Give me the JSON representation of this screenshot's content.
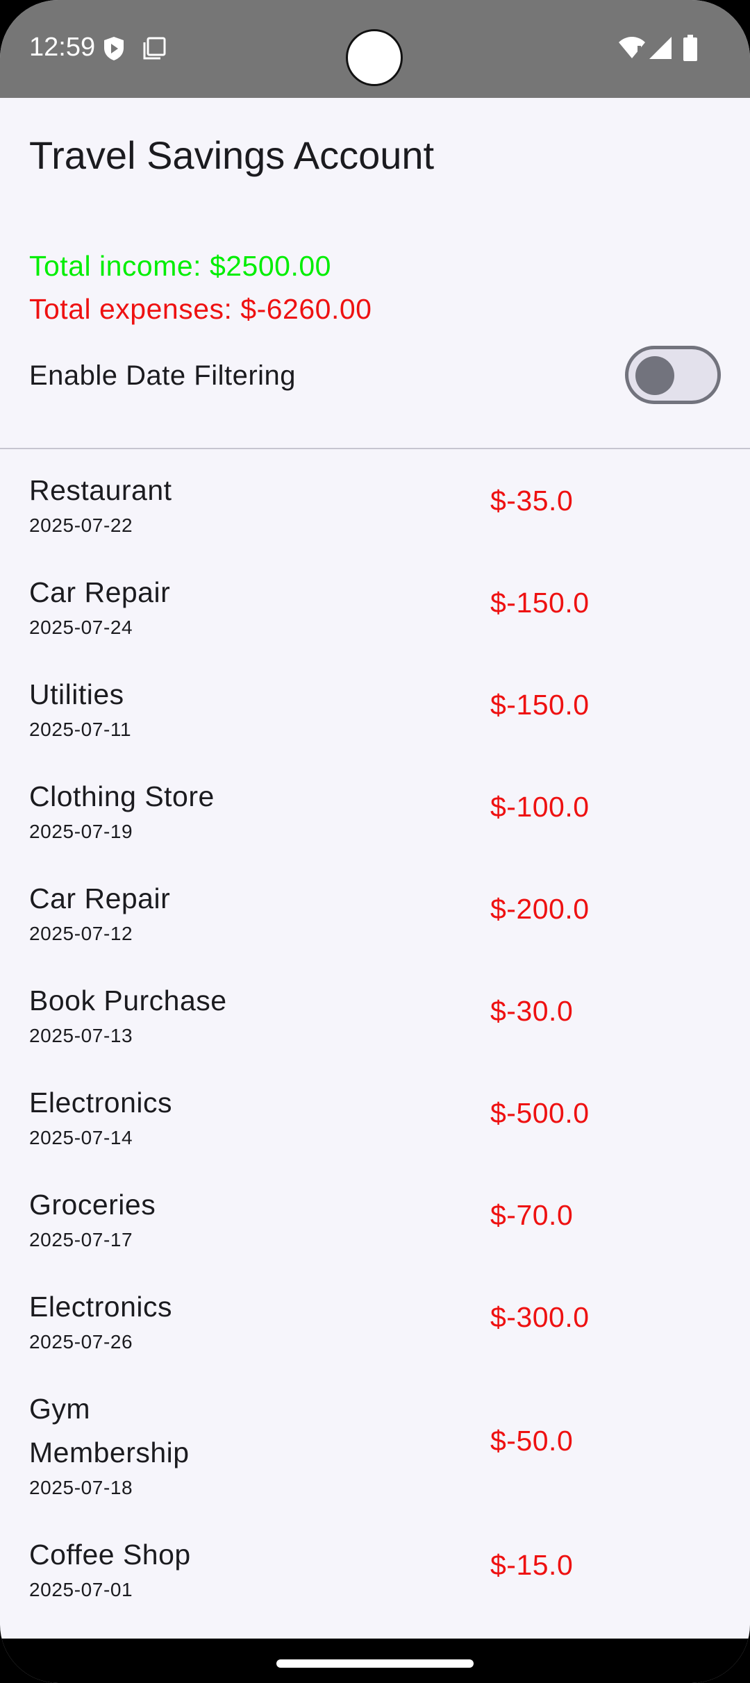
{
  "status_bar": {
    "time": "12:59",
    "icons_left": [
      "shield-icon",
      "screenshot-icon"
    ],
    "icons_right": [
      "wifi-icon",
      "signal-icon",
      "battery-icon"
    ]
  },
  "header": {
    "title": "Travel Savings Account"
  },
  "summary": {
    "total_income": "Total income: $2500.00",
    "total_expenses": "Total expenses: $-6260.00",
    "income_color": "#00ee00",
    "expense_color": "#ee1111"
  },
  "filter": {
    "label": "Enable Date Filtering",
    "enabled": false
  },
  "transactions": [
    {
      "name": "Restaurant",
      "date": "2025-07-22",
      "amount": "$-35.0"
    },
    {
      "name": "Car Repair",
      "date": "2025-07-24",
      "amount": "$-150.0"
    },
    {
      "name": "Utilities",
      "date": "2025-07-11",
      "amount": "$-150.0"
    },
    {
      "name": "Clothing Store",
      "date": "2025-07-19",
      "amount": "$-100.0"
    },
    {
      "name": "Car Repair",
      "date": "2025-07-12",
      "amount": "$-200.0"
    },
    {
      "name": "Book Purchase",
      "date": "2025-07-13",
      "amount": "$-30.0"
    },
    {
      "name": "Electronics",
      "date": "2025-07-14",
      "amount": "$-500.0"
    },
    {
      "name": "Groceries",
      "date": "2025-07-17",
      "amount": "$-70.0"
    },
    {
      "name": "Electronics",
      "date": "2025-07-26",
      "amount": "$-300.0"
    },
    {
      "name": "Gym Membership",
      "date": "2025-07-18",
      "amount": "$-50.0"
    },
    {
      "name": "Coffee Shop",
      "date": "2025-07-01",
      "amount": "$-15.0"
    }
  ]
}
